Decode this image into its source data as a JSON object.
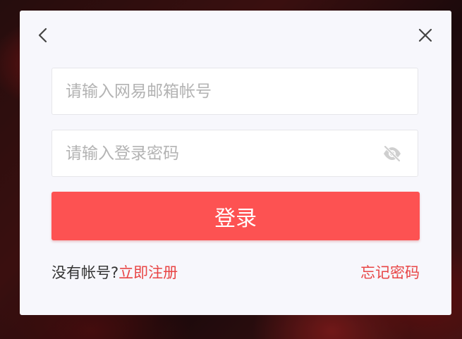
{
  "dialog": {
    "back_icon": "chevron-left-icon",
    "close_icon": "close-icon"
  },
  "account": {
    "placeholder": "请输入网易邮箱帐号",
    "value": ""
  },
  "password": {
    "placeholder": "请输入登录密码",
    "value": "",
    "visibility_icon": "eye-off-icon"
  },
  "login_button": {
    "label": "登录",
    "color": "#fd5252"
  },
  "footer": {
    "no_account_text": "没有帐号?",
    "register_link": "立即注册",
    "forgot_password_link": "忘记密码"
  },
  "colors": {
    "accent": "#e84545",
    "dialog_bg": "#f7f7fc"
  }
}
